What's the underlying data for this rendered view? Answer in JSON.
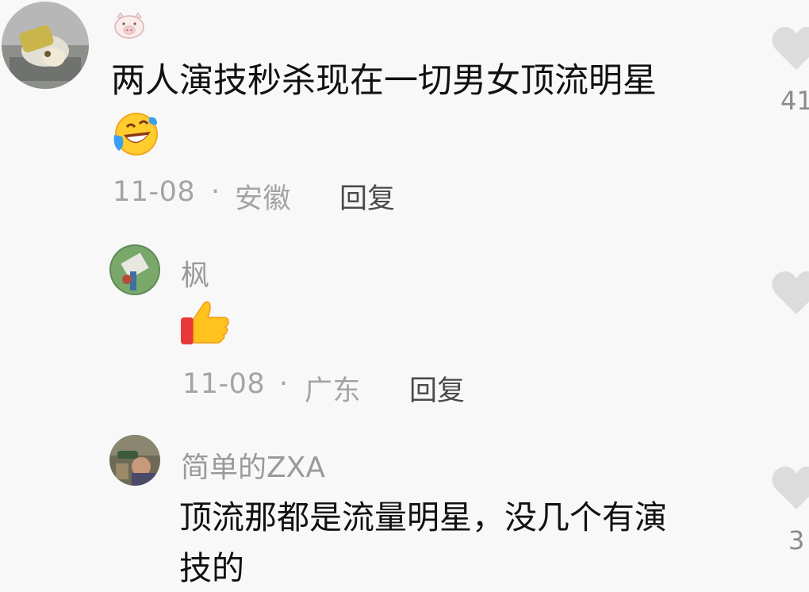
{
  "comments": [
    {
      "username_icon": "pig-face-icon",
      "text": "两人演技秒杀现在一切男女顶流明星",
      "emoji": "laughing-crying-emoji",
      "date": "11-08",
      "sep": "·",
      "location": "安徽",
      "reply_label": "回复",
      "like_count": "41"
    },
    {
      "username": "枫",
      "emoji": "thumbs-up-emoji",
      "date": "11-08",
      "sep": "·",
      "location": "广东",
      "reply_label": "回复"
    },
    {
      "username": "简单的ZXA",
      "text_line1": "顶流那都是流量明星，没几个有演",
      "text_line2": "技的",
      "like_count": "3"
    }
  ],
  "colors": {
    "background": "#f8f8f8",
    "primary_text": "#111111",
    "meta_text": "#a4a4a4",
    "heart": "#dcdcdc"
  }
}
